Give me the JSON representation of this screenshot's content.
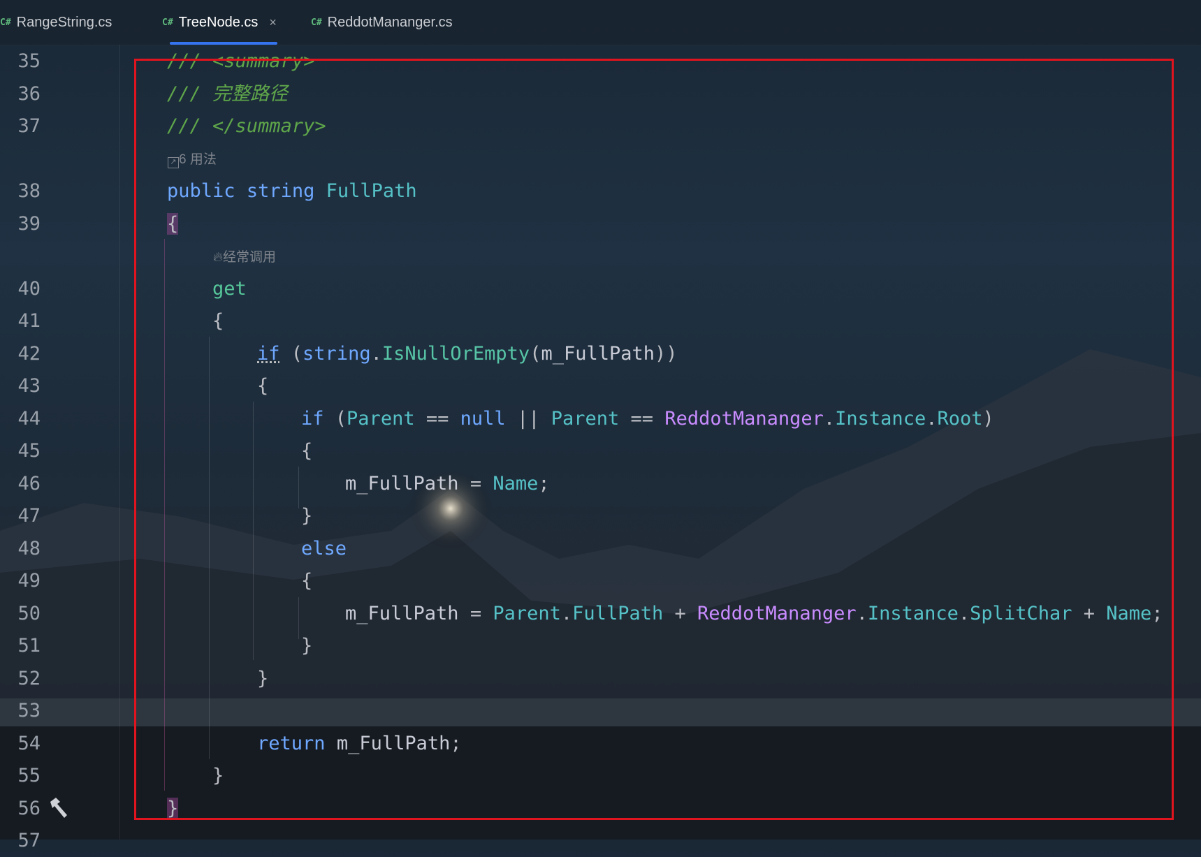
{
  "tabs": [
    {
      "lang": "C#",
      "label": "RangeString.cs",
      "active": false
    },
    {
      "lang": "C#",
      "label": "TreeNode.cs",
      "active": true,
      "close": "×"
    },
    {
      "lang": "C#",
      "label": "ReddotMananger.cs",
      "active": false
    }
  ],
  "line_numbers": [
    "35",
    "36",
    "37",
    "38",
    "39",
    "40",
    "41",
    "42",
    "43",
    "44",
    "45",
    "46",
    "47",
    "48",
    "49",
    "50",
    "51",
    "52",
    "53",
    "54",
    "55",
    "56",
    "57"
  ],
  "hints": {
    "usages": "6 用法",
    "frequent": "经常调用"
  },
  "code": {
    "l35": [
      "/// ",
      "<summary>"
    ],
    "l36": "/// 完整路径",
    "l37": [
      "/// ",
      "</summary>"
    ],
    "l38": [
      "public",
      "string",
      "FullPath"
    ],
    "l39": "{",
    "l40": "get",
    "l41": "{",
    "l42": [
      "if",
      "(",
      "string",
      ".",
      "IsNullOrEmpty",
      "(",
      "m_FullPath",
      "))"
    ],
    "l43": "{",
    "l44": [
      "if",
      "(",
      "Parent",
      "==",
      "null",
      "||",
      "Parent",
      "==",
      "ReddotMananger",
      ".",
      "Instance",
      ".",
      "Root",
      ")"
    ],
    "l45": "{",
    "l46": [
      "m_FullPath",
      "=",
      "Name",
      ";"
    ],
    "l47": "}",
    "l48": "else",
    "l49": "{",
    "l50": [
      "m_FullPath",
      "=",
      "Parent",
      ".",
      "FullPath",
      "+",
      "ReddotMananger",
      ".",
      "Instance",
      ".",
      "SplitChar",
      "+",
      "Name",
      ";"
    ],
    "l51": "}",
    "l52": "}",
    "l54": [
      "return",
      "m_FullPath",
      ";"
    ],
    "l55": "}",
    "l56": "}"
  },
  "colors": {
    "highlight_box": "#e0141e",
    "tab_underline": "#3574f0"
  }
}
